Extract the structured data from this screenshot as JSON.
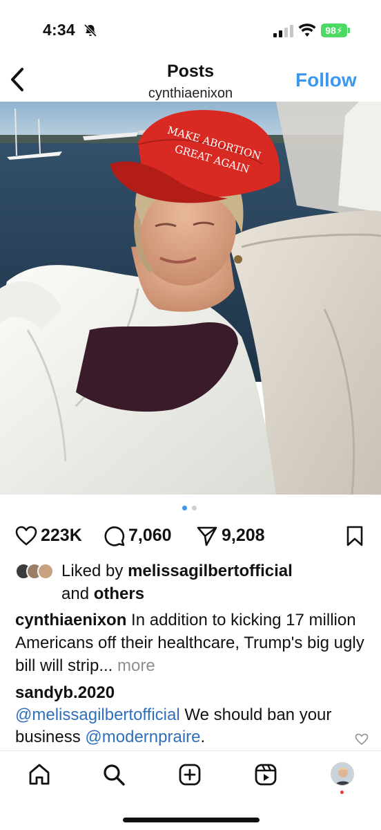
{
  "status_bar": {
    "time": "4:34",
    "battery": "98",
    "icons": [
      "bell-slash-icon",
      "cellular-signal-icon",
      "wifi-icon",
      "battery-charging-icon"
    ]
  },
  "header": {
    "title": "Posts",
    "username": "cynthiaenixon",
    "follow_label": "Follow",
    "back_icon": "chevron-left-icon"
  },
  "post": {
    "hat_text_line1": "MAKE ABORTION",
    "hat_text_line2": "GREAT AGAIN",
    "carousel": {
      "count": 2,
      "active": 1
    },
    "likes": "223K",
    "comments": "7,060",
    "shares": "9,208",
    "liked_by_prefix": "Liked by",
    "liked_by_user": "melissagilbertofficial",
    "liked_by_and": "and",
    "liked_by_others": "others",
    "caption_user": "cynthiaenixon",
    "caption_text": "In addition to kicking 17 million Americans off their healthcare, Trump's big ugly bill will strip...",
    "caption_more": "more"
  },
  "comment": {
    "user": "sandyb.2020",
    "mention1": "@melissagilbertofficial",
    "text1": "We should ban your business",
    "mention2": "@modernpraire",
    "text2": "."
  },
  "nav": {
    "items": [
      "home-icon",
      "search-icon",
      "create-icon",
      "reels-icon",
      "profile-avatar"
    ]
  },
  "colors": {
    "accent": "#3b97f0",
    "mention": "#2f6fbd",
    "battery": "#4cd964",
    "muted": "#8e8e8e",
    "notification": "#ff3040"
  }
}
